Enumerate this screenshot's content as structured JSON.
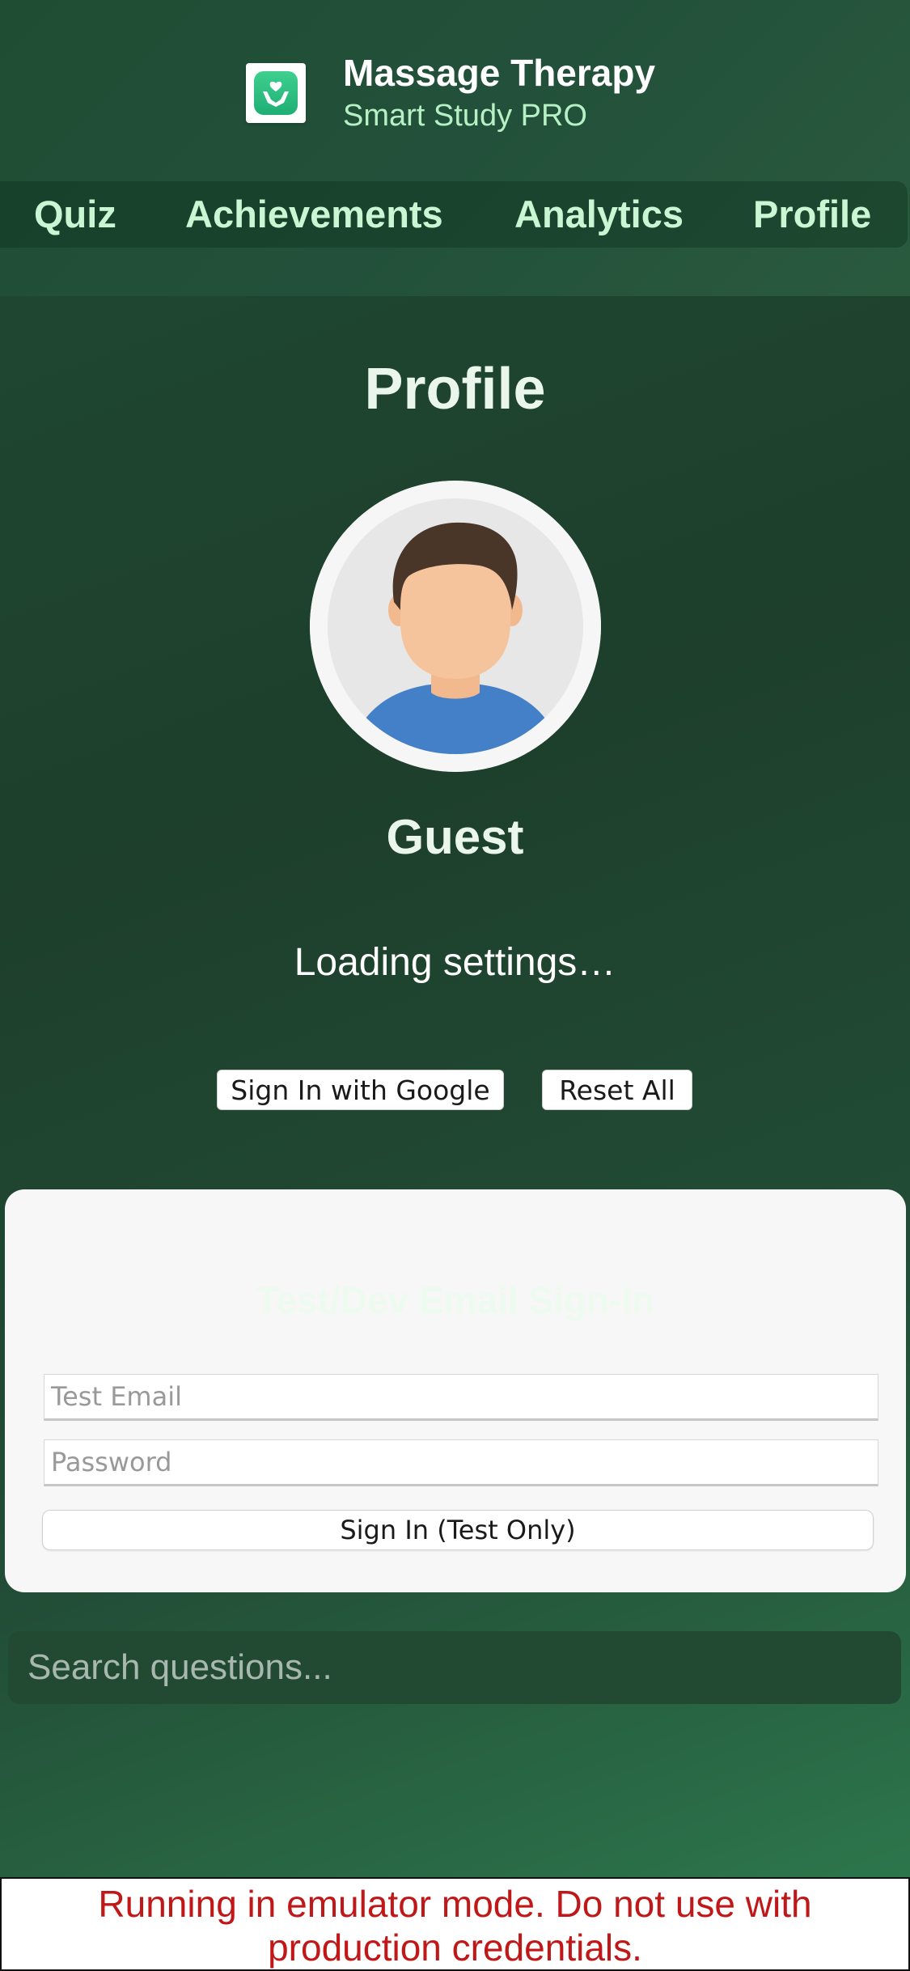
{
  "header": {
    "icon": "helping-hands-icon",
    "title": "Massage Therapy",
    "subtitle": "Smart Study PRO"
  },
  "nav": {
    "items": [
      {
        "label": "Quiz"
      },
      {
        "label": "Achievements"
      },
      {
        "label": "Analytics"
      },
      {
        "label": "Profile"
      }
    ]
  },
  "profile": {
    "title": "Profile",
    "avatar_icon": "default-user-avatar",
    "name": "Guest",
    "status": "Loading settings…",
    "google_button": "Sign In with Google",
    "reset_button": "Reset All"
  },
  "test_signin": {
    "title": "Test/Dev Email Sign-In",
    "email_placeholder": "Test Email",
    "password_placeholder": "Password",
    "submit_button": "Sign In (Test Only)"
  },
  "search": {
    "placeholder": "Search questions..."
  },
  "emulator_banner": {
    "line1": "Running in emulator mode. Do not use with",
    "line2": "production credentials."
  },
  "colors": {
    "background": "#1f4a34",
    "nav_text": "#c9f7d3",
    "subtitle": "#b6f0c4",
    "banner_text": "#c01818",
    "app_icon": "#2bbf80"
  }
}
